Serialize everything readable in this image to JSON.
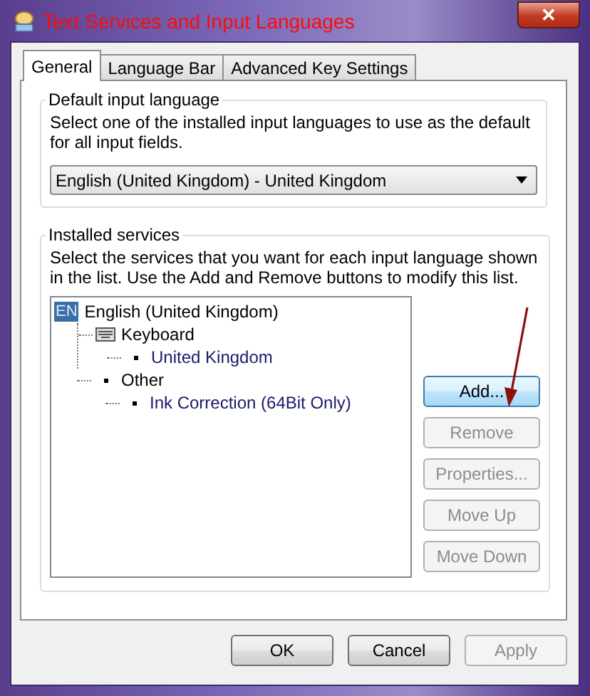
{
  "window": {
    "title": "Text Services and Input Languages",
    "close": "✕"
  },
  "tabs": [
    {
      "label": "General",
      "selected": true
    },
    {
      "label": "Language Bar",
      "selected": false
    },
    {
      "label": "Advanced Key Settings",
      "selected": false
    }
  ],
  "default_group": {
    "title": "Default input language",
    "description": "Select one of the installed input languages to use as the default for all input fields.",
    "dropdown": {
      "value": "English (United Kingdom) - United Kingdom"
    }
  },
  "services_group": {
    "title": "Installed services",
    "description": "Select the services that you want for each input language shown in the list. Use the Add and Remove buttons to modify this list.",
    "tree": [
      {
        "kind": "language",
        "badge": "EN",
        "label": "English (United Kingdom)",
        "children": [
          {
            "kind": "keyboard",
            "label": "Keyboard",
            "children": [
              {
                "kind": "item",
                "label": "United Kingdom"
              }
            ]
          },
          {
            "kind": "category",
            "label": "Other",
            "children": [
              {
                "kind": "item",
                "label": "Ink Correction (64Bit Only)"
              }
            ]
          }
        ]
      }
    ],
    "buttons": [
      {
        "label": "Add...",
        "disabled": false,
        "focused": true
      },
      {
        "label": "Remove",
        "disabled": true,
        "focused": false
      },
      {
        "label": "Properties...",
        "disabled": true,
        "focused": false
      },
      {
        "label": "Move Up",
        "disabled": true,
        "focused": false
      },
      {
        "label": "Move Down",
        "disabled": true,
        "focused": false
      }
    ]
  },
  "footer_buttons": [
    {
      "label": "OK",
      "disabled": false
    },
    {
      "label": "Cancel",
      "disabled": false
    },
    {
      "label": "Apply",
      "disabled": true
    }
  ]
}
